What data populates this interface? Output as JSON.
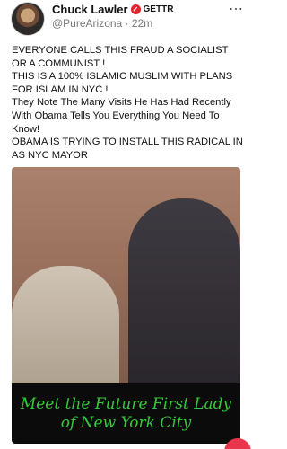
{
  "post": {
    "author_name": "Chuck Lawler",
    "platform_badge": "GETTR",
    "handle": "@PureArizona",
    "separator": "·",
    "time_ago": "22m",
    "more_icon": "more-horizontal-icon",
    "paragraphs": [
      "EVERYONE CALLS THIS FRAUD A SOCIALIST OR A COMMUNIST !",
      "THIS IS A 100% ISLAMIC MUSLIM WITH PLANS FOR ISLAM IN NYC !",
      "They Note The Many Visits He Has Had Recently With Obama Tells You Everything You Need To Know!",
      "OBAMA IS TRYING TO INSTALL THIS RADICAL IN AS NYC MAYOR"
    ],
    "media": {
      "caption_line1": "Meet the Future First Lady",
      "caption_line2": "of New York City",
      "caption_color": "#34c93b"
    }
  },
  "colors": {
    "verified": "#e3262f",
    "fab": "#e8364c",
    "handle": "#777777"
  }
}
